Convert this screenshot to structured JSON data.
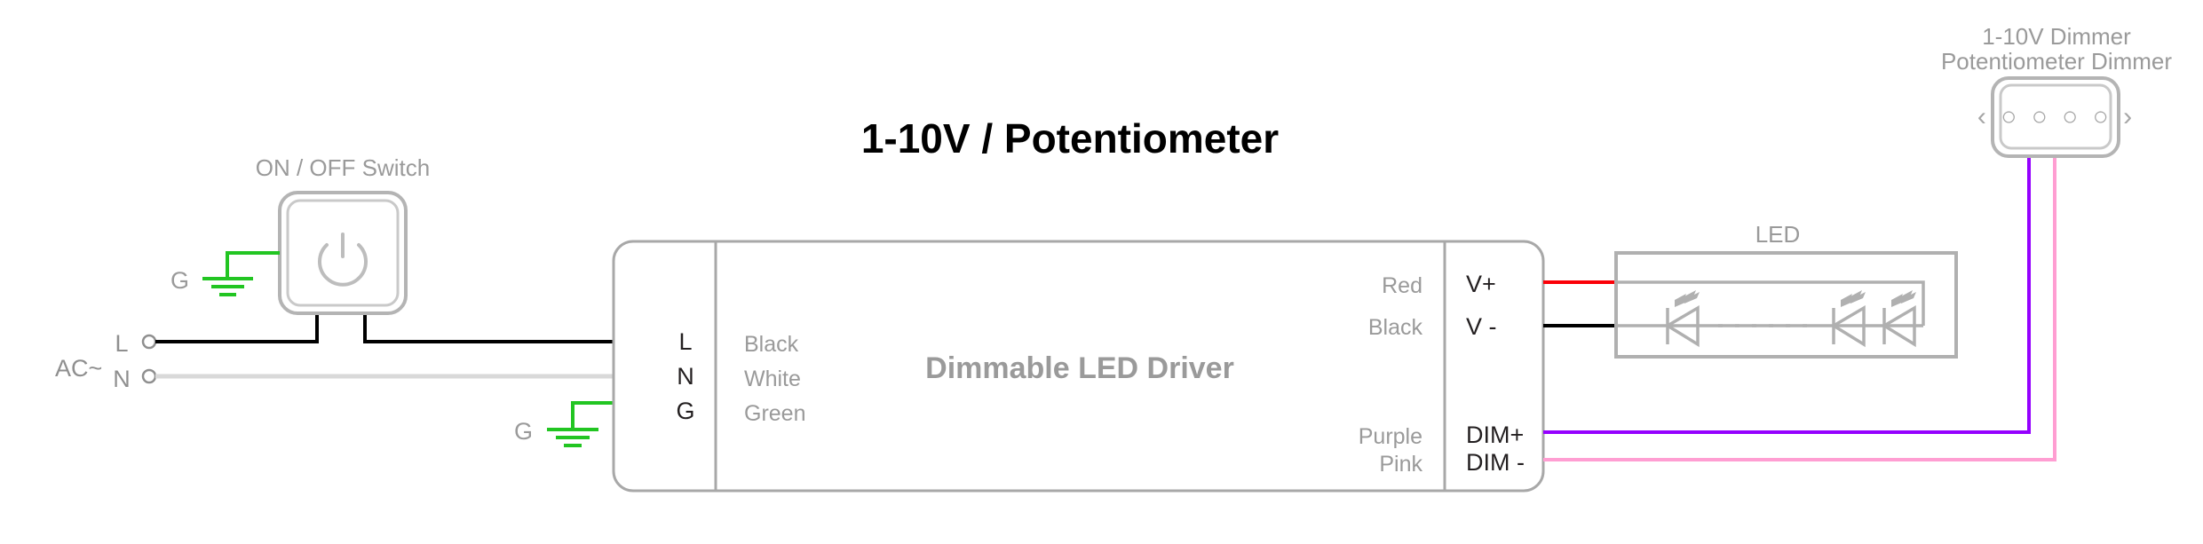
{
  "diagram": {
    "title": "1-10V / Potentiometer",
    "background_color": "#ffffff"
  },
  "source": {
    "label": "AC~",
    "terminals": [
      {
        "name": "L",
        "label": "L",
        "wire_color_name": "black",
        "wire_color": "#000000"
      },
      {
        "name": "N",
        "label": "N",
        "wire_color_name": "white",
        "wire_color": "#d9d9d9"
      }
    ]
  },
  "switch": {
    "label": "ON / OFF Switch",
    "icon": "power-icon",
    "ground_label": "G",
    "ground_wire_color": "#22c522"
  },
  "driver": {
    "label": "Dimmable LED Driver",
    "ground_label": "G",
    "input_terminals": [
      {
        "terminal": "L",
        "wire_color_name": "Black",
        "wire_color": "#000000"
      },
      {
        "terminal": "N",
        "wire_color_name": "White",
        "wire_color": "#d9d9d9"
      },
      {
        "terminal": "G",
        "wire_color_name": "Green",
        "wire_color": "#22c522"
      }
    ],
    "output_terminals": [
      {
        "terminal": "V+",
        "wire_color_name": "Red",
        "wire_color": "#fb0007"
      },
      {
        "terminal": "V -",
        "wire_color_name": "Black",
        "wire_color": "#000000"
      },
      {
        "terminal": "DIM+",
        "wire_color_name": "Purple",
        "wire_color": "#9500ff"
      },
      {
        "terminal": "DIM -",
        "wire_color_name": "Pink",
        "wire_color": "#ff9ed2"
      }
    ]
  },
  "led": {
    "label": "LED",
    "symbol_count": 3,
    "continuation": "dotted"
  },
  "dimmer": {
    "label_line1": "1-10V Dimmer",
    "label_line2": "Potentiometer Dimmer",
    "face_icon": "‹ ○ ○ ○ ○ ›",
    "wires": [
      {
        "name": "DIM+",
        "color_name": "Purple",
        "color": "#9500ff"
      },
      {
        "name": "DIM -",
        "color_name": "Pink",
        "color": "#ff9ed2"
      }
    ]
  }
}
